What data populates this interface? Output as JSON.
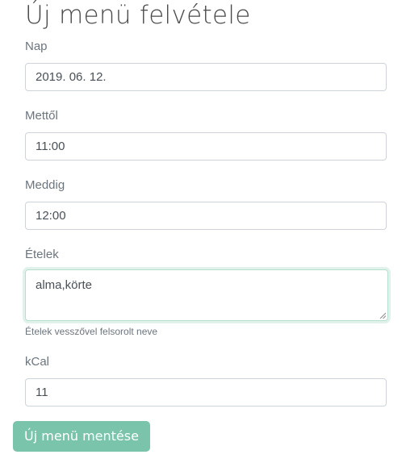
{
  "page": {
    "title": "Új menü felvétele"
  },
  "form": {
    "date": {
      "label": "Nap",
      "value": "2019. 06. 12."
    },
    "from": {
      "label": "Mettől",
      "value": "11:00"
    },
    "to": {
      "label": "Meddig",
      "value": "12:00"
    },
    "foods": {
      "label": "Ételek",
      "value": "alma,körte",
      "help": "Ételek vesszővel felsorolt neve"
    },
    "kcal": {
      "label": "kCal",
      "value": "11"
    },
    "submit_label": "Új menü mentése"
  },
  "colors": {
    "button": "#79c4aa",
    "focus_border": "#b7dfcd"
  }
}
